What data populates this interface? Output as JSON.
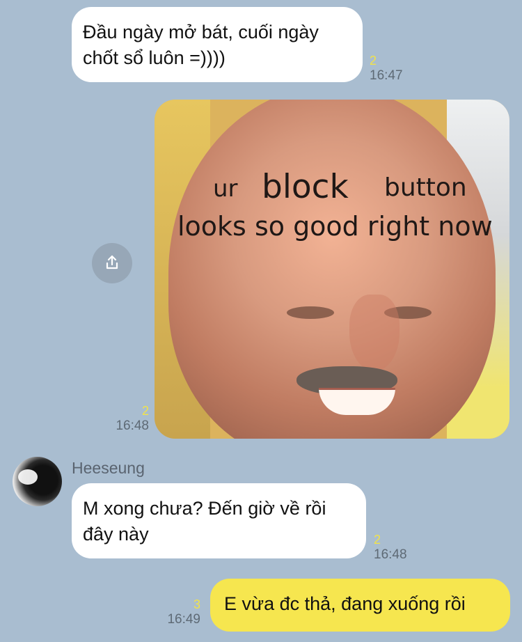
{
  "messages": {
    "msg1": {
      "text_line1": "Đầu ngày mở bát, cuối ngày",
      "text_line2": "chốt sổ luôn =))))",
      "read_count": "2",
      "time": "16:47"
    },
    "meme": {
      "line1_part1": "ur",
      "line1_part2": "block",
      "line1_part3": "button",
      "line2": "looks so good right now",
      "read_count": "2",
      "time": "16:48",
      "share_icon": "share-icon"
    },
    "msg3": {
      "sender": "Heeseung",
      "text_line1": "M xong chưa? Đến giờ về rồi",
      "text_line2": "đây này",
      "read_count": "2",
      "time": "16:48"
    },
    "msg4": {
      "text": "E vừa đc thả, đang xuống rồi",
      "read_count": "3",
      "time": "16:49"
    }
  },
  "colors": {
    "background": "#a9bdd0",
    "incoming_bubble": "#ffffff",
    "outgoing_yellow": "#f6e64f",
    "read_count": "#f1e24a"
  }
}
